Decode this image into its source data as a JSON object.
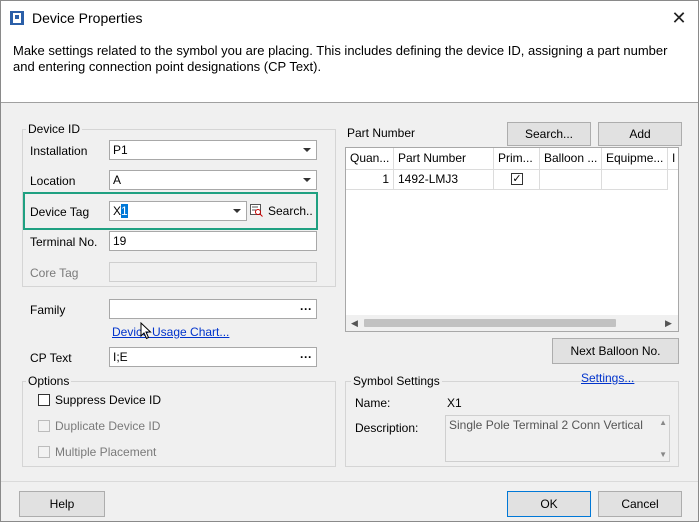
{
  "window": {
    "title": "Device Properties",
    "app_icon": "device-properties-icon",
    "close_glyph": "✕"
  },
  "description": "Make settings related to the symbol you are placing. This includes defining the device ID, assigning a part number and entering connection point designations (CP Text).",
  "device_id": {
    "legend": "Device ID",
    "installation_label": "Installation",
    "installation_value": "P1",
    "location_label": "Location",
    "location_value": "A",
    "device_tag_label": "Device Tag",
    "device_tag_prefix": "X",
    "device_tag_selected": "1",
    "search_label": "Search..",
    "terminal_label": "Terminal No.",
    "terminal_value": "19",
    "core_tag_label": "Core Tag",
    "core_tag_value": ""
  },
  "family": {
    "label": "Family",
    "value": "",
    "usage_chart_link": "Device Usage Chart...",
    "cp_text_label": "CP Text",
    "cp_text_value": "I;E"
  },
  "options": {
    "legend": "Options",
    "suppress_label": "Suppress Device ID",
    "duplicate_label": "Duplicate Device ID",
    "multiple_label": "Multiple Placement"
  },
  "part_number": {
    "label": "Part Number",
    "search_button": "Search...",
    "add_button": "Add",
    "columns": [
      "Quan...",
      "Part Number",
      "Prim...",
      "Balloon ...",
      "Equipme...",
      "I"
    ],
    "rows": [
      {
        "quantity": "1",
        "part_number": "1492-LMJ3",
        "primary": true,
        "balloon": "",
        "equipment": ""
      }
    ],
    "primary_check_glyph": "✓",
    "next_balloon_button": "Next Balloon No."
  },
  "symbol_settings": {
    "legend": "Symbol Settings",
    "settings_link": "Settings...",
    "name_label": "Name:",
    "name_value": "X1",
    "description_label": "Description:",
    "description_value": "Single Pole Terminal 2 Conn Vertical"
  },
  "footer": {
    "help_button": "Help",
    "ok_button": "OK",
    "cancel_button": "Cancel"
  },
  "colors": {
    "highlight": "#1fa081",
    "link": "#0033cc",
    "selection": "#0078d7"
  }
}
